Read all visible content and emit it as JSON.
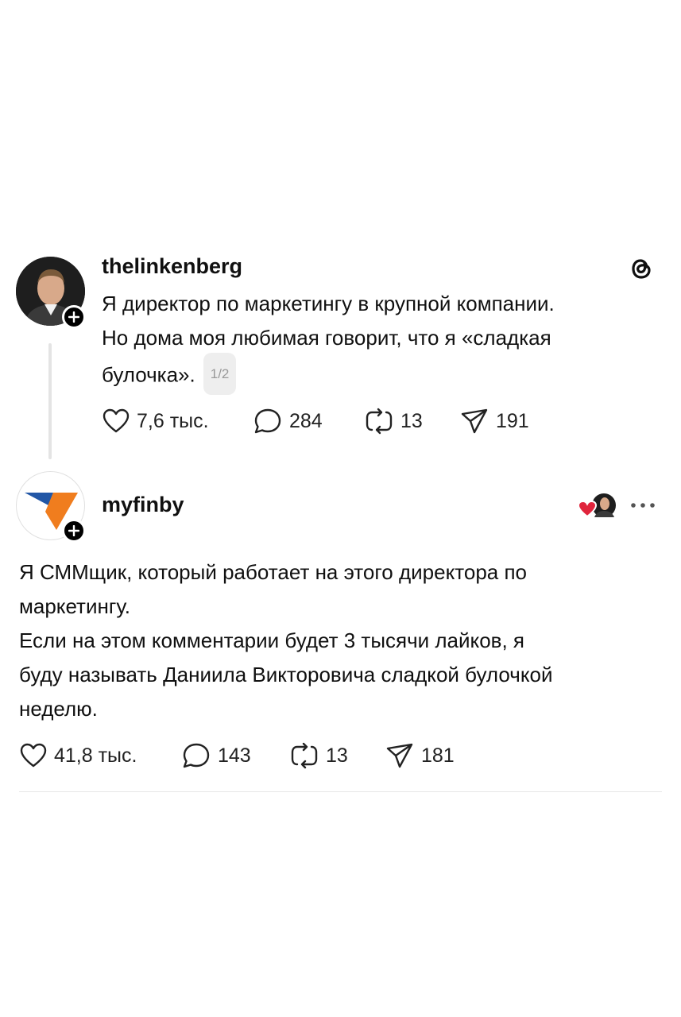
{
  "post": {
    "username": "thelinkenberg",
    "lines": [
      "Я директор по маркетингу в крупной компании.",
      "Но дома моя любимая говорит, что я «сладкая",
      "булочка»."
    ],
    "pager": "1/2",
    "likes": "7,6 тыс.",
    "comments": "284",
    "reposts": "13",
    "shares": "191"
  },
  "reply": {
    "username": "myfinby",
    "lines": [
      "Я СММщик, который работает на этого директора по",
      "маркетингу.",
      "Если на этом комментарии будет 3 тысячи лайков, я",
      "буду называть Даниила Викторовича сладкой булочкой",
      "неделю."
    ],
    "likes": "41,8 тыс.",
    "comments": "143",
    "reposts": "13",
    "shares": "181"
  },
  "colors": {
    "logo_blue": "#2257a6",
    "logo_orange": "#f07d1e",
    "heart": "#e0243c"
  },
  "icons": [
    "threads-logo-icon",
    "plus-icon",
    "heart-icon",
    "comment-icon",
    "repost-icon",
    "share-icon",
    "more-icon",
    "liked-by-author-icon"
  ]
}
